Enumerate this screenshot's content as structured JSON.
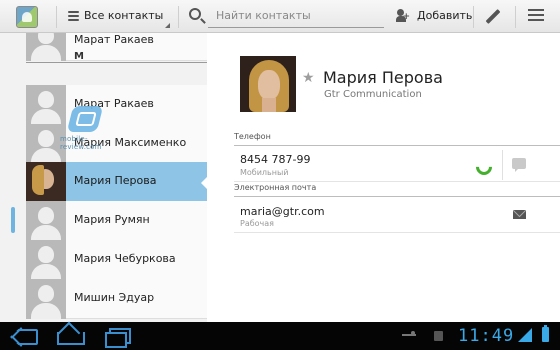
{
  "toolbar": {
    "filter_label": "Все контакты",
    "search_placeholder": "Найти контакты",
    "add_label": "Добавить"
  },
  "list": {
    "section_letter": "М",
    "contacts": [
      {
        "name": "Марат Ракаев",
        "selected": false
      },
      {
        "name": "Марат Ракаев",
        "selected": false
      },
      {
        "name": "Мария Максименко",
        "selected": false
      },
      {
        "name": "Мария Перова",
        "selected": true
      },
      {
        "name": "Мария Румян",
        "selected": false
      },
      {
        "name": "Мария Чебуркова",
        "selected": false
      },
      {
        "name": "Мишин Эдуар",
        "selected": false
      }
    ],
    "watermark_text": "mobile-review.com"
  },
  "detail": {
    "name": "Мария Перова",
    "company": "Gtr Communication",
    "phone_section": "Телефон",
    "phone": "8454 787-99",
    "phone_type": "Мобильный",
    "email_section": "Электронная почта",
    "email": "maria@gtr.com",
    "email_type": "Рабочая"
  },
  "system": {
    "clock": "11:49"
  },
  "colors": {
    "accent": "#39a9e8",
    "selection": "#8ec5e6",
    "call_green": "#44b02e"
  }
}
